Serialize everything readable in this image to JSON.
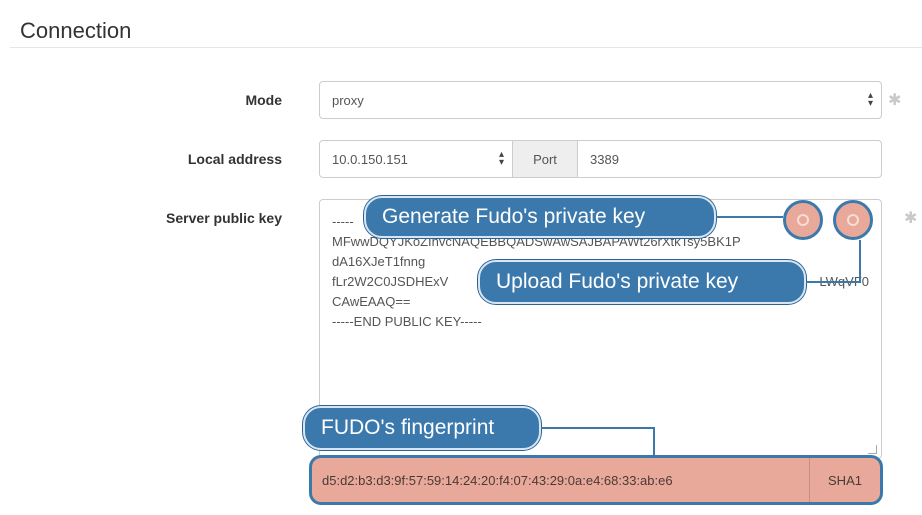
{
  "section": {
    "title": "Connection"
  },
  "mode": {
    "label": "Mode",
    "value": "proxy"
  },
  "local_address": {
    "label": "Local address",
    "value": "10.0.150.151",
    "port_label": "Port",
    "port_value": "3389"
  },
  "server_public_key": {
    "label": "Server public key",
    "lines": [
      "-----",
      "MFwwDQYJKoZIhvcNAQEBBQADSwAwSAJBAPAWt26rXtkTsy5BK1P",
      "dA16XJeT1fnng",
      "fLr2W2C0JSDHExV",
      "CAwEAAQ==",
      "-----END PUBLIC KEY-----"
    ],
    "line3_tail": "LWqVF0"
  },
  "fingerprint": {
    "value": "d5:d2:b3:d3:9f:57:59:14:24:20:f4:07:43:29:0a:e4:68:33:ab:e6",
    "algorithm": "SHA1"
  },
  "callouts": {
    "generate": "Generate Fudo's private key",
    "upload": "Upload Fudo's private key",
    "fingerprint": "FUDO's fingerprint"
  },
  "icons": {
    "required": "asterisk-icon",
    "select": "select-arrows-icon",
    "generate": "generate-key-icon",
    "upload": "upload-key-icon"
  },
  "colors": {
    "callout": "#3b79ad",
    "highlight": "#e9a99a"
  }
}
